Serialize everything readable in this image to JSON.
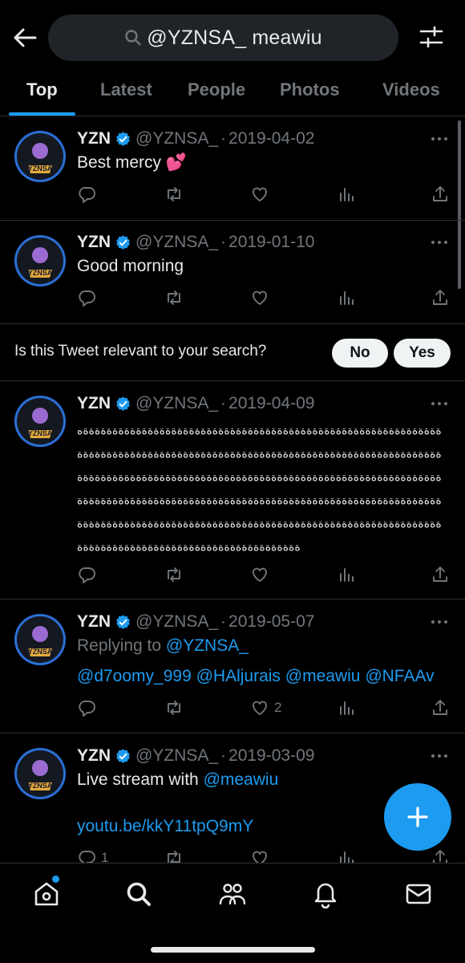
{
  "search": {
    "query": "@YZNSA_ meawiu"
  },
  "tabs": [
    {
      "label": "Top",
      "active": true
    },
    {
      "label": "Latest"
    },
    {
      "label": "People"
    },
    {
      "label": "Photos"
    },
    {
      "label": "Videos"
    }
  ],
  "avatar_text": "YZNSA",
  "tweets": [
    {
      "name": "YZN",
      "handle": "@YZNSA_",
      "dot": "·",
      "date": "2019-04-02",
      "text": "Best mercy 💕"
    },
    {
      "name": "YZN",
      "handle": "@YZNSA_",
      "dot": "·",
      "date": "2019-01-10",
      "text": "Good morning"
    },
    {
      "name": "YZN",
      "handle": "@YZNSA_",
      "dot": "·",
      "date": "2019-04-09",
      "text_lines": [
        "ةةةةةةةةةةةةةةةةةةةةةةةةةةةةةةةةةةةةةةةةةةةةةةةةةةةةةةةةةةةةةه",
        "ةةةةةةةةةةةةةةةةةةةةةةةةةةةةةةةةةةةةةةةةةةةةةةةةةةةةةةةةةةةةةة",
        "ةةةةةةةةةةةةةةةةةةةةةةةةةةةةةةةةةةةةةةةةةةةةةةةةةةةةةةةةةةةةةة",
        "ةةةةةةةةةةةةةةةةةةةةةةةةةةةةةةةةةةةةةةةةةةةةةةةةةةةةةةةةةةةةةة",
        "ةةةةةةةةةةةةةةةةةةةةةةةةةةةةةةةةةةةةةةةةةةةةةةةةةةةةةةةةةةةةةة",
        "ةةةةةةةةةةةةةةةةةةةةةةةةةةةةةةةةةةةةةة"
      ]
    },
    {
      "name": "YZN",
      "handle": "@YZNSA_",
      "dot": "·",
      "date": "2019-05-07",
      "replying_prefix": "Replying to ",
      "replying_to": "@YZNSA_",
      "mentions": [
        "@d7oomy_999",
        "@HAljurais",
        "@meawiu",
        "@NFAAv"
      ],
      "like_count": "2"
    },
    {
      "name": "YZN",
      "handle": "@YZNSA_",
      "dot": "·",
      "date": "2019-03-09",
      "text_prefix": "Live stream with ",
      "text_mention": "@meawiu",
      "link": "youtu.be/kkY11tpQ9mY",
      "reply_count": "1"
    }
  ],
  "relevance": {
    "question": "Is this Tweet relevant to your search?",
    "no_label": "No",
    "yes_label": "Yes"
  },
  "colors": {
    "accent": "#1d9bf0",
    "background": "#000000",
    "text": "#e7e9ea",
    "muted": "#71767b",
    "divider": "#2f3336"
  },
  "icons": {
    "header": [
      "back-arrow-icon",
      "search-icon",
      "filter-sliders-icon"
    ],
    "tweet_actions": [
      "reply-icon",
      "retweet-icon",
      "like-icon",
      "views-icon",
      "share-icon"
    ],
    "bottom_nav": [
      "home-icon",
      "search-icon",
      "communities-icon",
      "notifications-icon",
      "messages-icon"
    ],
    "fab": "compose-plus-icon"
  }
}
